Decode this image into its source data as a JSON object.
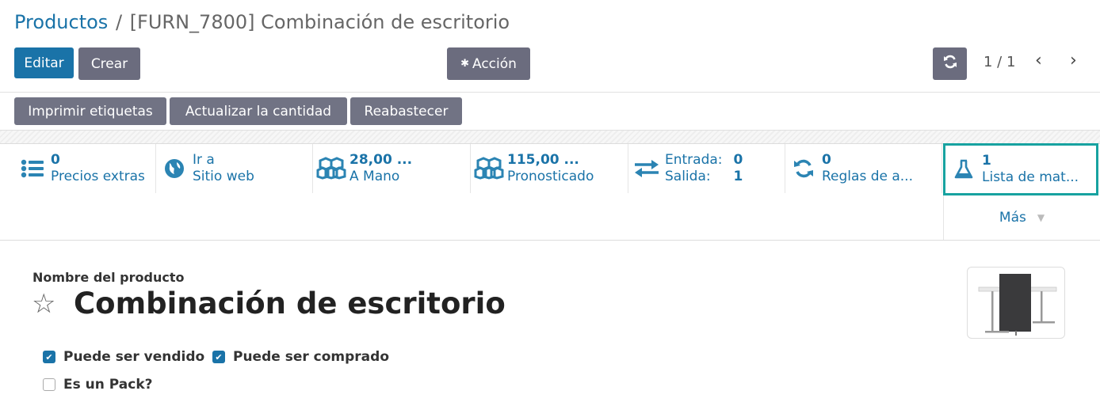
{
  "breadcrumb": {
    "parent": "Productos",
    "separator": "/",
    "current": "[FURN_7800] Combinación de escritorio"
  },
  "toolbar": {
    "edit_label": "Editar",
    "create_label": "Crear",
    "action_label": "Acción",
    "pager": "1 / 1"
  },
  "header_buttons": {
    "print_labels": "Imprimir etiquetas",
    "update_qty": "Actualizar la cantidad",
    "replenish": "Reabastecer"
  },
  "smart_buttons": {
    "prices": {
      "value": "0",
      "label": "Precios extras",
      "icon": "list-icon"
    },
    "website": {
      "value": "Ir a",
      "label": "Sitio web",
      "icon": "globe-icon"
    },
    "on_hand": {
      "value": "28,00 ...",
      "label": "A Mano",
      "icon": "cubes-icon"
    },
    "forecast": {
      "value": "115,00 ...",
      "label": "Pronosticado",
      "icon": "cubes-icon"
    },
    "in_out": {
      "in_label": "Entrada:",
      "in_value": "0",
      "out_label": "Salida:",
      "out_value": "1",
      "icon": "exchange-icon"
    },
    "rules": {
      "value": "0",
      "label": "Reglas de a...",
      "icon": "refresh-icon"
    },
    "bom": {
      "value": "1",
      "label": "Lista de mat...",
      "icon": "flask-icon"
    },
    "more_label": "Más"
  },
  "form": {
    "name_label": "Nombre del producto",
    "product_name": "Combinación de escritorio",
    "can_be_sold": {
      "label": "Puede ser vendido",
      "checked": true
    },
    "can_be_purchased": {
      "label": "Puede ser comprado",
      "checked": true
    },
    "is_pack": {
      "label": "Es un Pack?",
      "checked": false
    }
  },
  "colors": {
    "primary": "#1a73a8",
    "secondary": "#6b6c7e",
    "highlight": "#17a2a0"
  }
}
